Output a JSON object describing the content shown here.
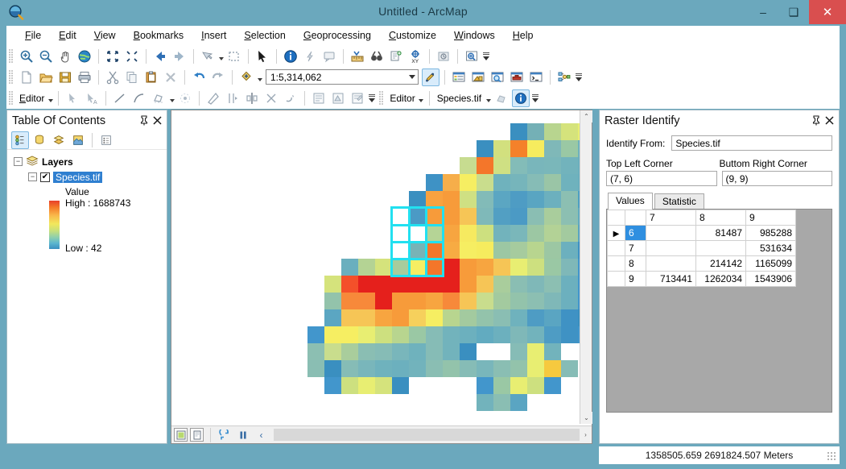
{
  "window": {
    "title": "Untitled - ArcMap",
    "app_icon": "magnifier-globe-icon",
    "minimize": "–",
    "maximize": "❑",
    "close": "✕"
  },
  "menu": {
    "items": [
      {
        "label": "File",
        "accel": "F"
      },
      {
        "label": "Edit",
        "accel": "E"
      },
      {
        "label": "View",
        "accel": "V"
      },
      {
        "label": "Bookmarks",
        "accel": "B"
      },
      {
        "label": "Insert",
        "accel": "I"
      },
      {
        "label": "Selection",
        "accel": "S"
      },
      {
        "label": "Geoprocessing",
        "accel": "G"
      },
      {
        "label": "Customize",
        "accel": "C"
      },
      {
        "label": "Windows",
        "accel": "W"
      },
      {
        "label": "Help",
        "accel": "H"
      }
    ]
  },
  "toolbars": {
    "tools": {
      "icons": [
        "zoom-in-icon",
        "zoom-out-icon",
        "pan-icon",
        "full-extent-globe-icon",
        "fixed-zoom-in-icon",
        "fixed-zoom-out-icon",
        "go-back-extent-icon",
        "go-forward-extent-icon",
        "select-features-icon",
        "select-rectangle-icon",
        "select-elements-arrow-icon",
        "identify-icon",
        "hyperlink-icon",
        "html-popup-icon",
        "measure-icon",
        "find-icon",
        "find-route-icon",
        "go-to-xy-icon",
        "time-slider-icon",
        "create-viewer-window-icon"
      ]
    },
    "standard": {
      "icons": [
        "new-map-icon",
        "open-icon",
        "save-icon",
        "print-icon",
        "cut-icon",
        "copy-icon",
        "paste-icon",
        "delete-icon",
        "undo-icon",
        "redo-icon",
        "add-data-icon"
      ],
      "scale_label": "1:5,314,062",
      "right_icons": [
        "editor-toolbar-icon",
        "table-of-contents-icon",
        "catalog-icon",
        "search-icon",
        "arctoolbox-icon",
        "python-window-icon",
        "model-builder-icon"
      ]
    },
    "editor": {
      "menu_label": "Editor",
      "icons": [
        "edit-tool-icon",
        "edit-annotation-icon",
        "straight-segment-icon",
        "arc-segment-icon",
        "trace-icon",
        "point-icon",
        "rotate-icon",
        "split-icon",
        "mirror-icon",
        "cut-polygons-icon",
        "reshape-icon",
        "attributes-icon",
        "sketch-properties-icon",
        "create-features-icon"
      ]
    },
    "raster_identify_bar": {
      "menu_label": "Editor",
      "layer": "Species.tif",
      "icons": [
        "raster-select-icon",
        "raster-identify-icon"
      ]
    }
  },
  "toc": {
    "title": "Table Of Contents",
    "pin_icon": "pin-icon",
    "close_icon": "close-icon",
    "toolbar_icons": [
      "list-by-drawing-order-icon",
      "list-by-source-icon",
      "list-by-visibility-icon",
      "list-by-selection-icon",
      "options-icon"
    ],
    "root": "Layers",
    "layer": "Species.tif",
    "layer_checked": "✔",
    "legend": {
      "heading": "Value",
      "high": "High : 1688743",
      "low": "Low : 42",
      "ramp_colors": [
        "#e8402a",
        "#f47b28",
        "#f9b64a",
        "#f2e85c",
        "#c9e07a",
        "#8dcfae",
        "#5bb6cf",
        "#3a8fc0"
      ]
    }
  },
  "map": {
    "bottom_icons": [
      "data-view-icon",
      "layout-view-icon",
      "refresh-icon",
      "pause-drawing-icon",
      "previous-extent-icon"
    ],
    "scroll_left_icon": "‹",
    "scroll_right_icon": "›",
    "scroll_up_icon": "⌃",
    "scroll_down_icon": "⌄",
    "selection": {
      "cols": 3,
      "rows": 4,
      "top_left": "(7, 6)",
      "bottom_right": "(9, 9)",
      "outline_color": "#22e0f0"
    }
  },
  "raster_identify": {
    "title": "Raster Identify",
    "pin_icon": "pin-icon",
    "close_icon": "close-icon",
    "identify_from_label": "Identify From:",
    "identify_from_value": "Species.tif",
    "top_left_label": "Top Left Corner",
    "top_left_value": "(7, 6)",
    "bottom_right_label": "Buttom Right Corner",
    "bottom_right_value": "(9, 9)",
    "tabs": [
      {
        "label": "Values",
        "active": true
      },
      {
        "label": "Statistic",
        "active": false
      }
    ],
    "table": {
      "column_headers": [
        "7",
        "8",
        "9"
      ],
      "rows": [
        {
          "header": "6",
          "active": true,
          "indicator": "▶",
          "cells": [
            "",
            "81487",
            "985288"
          ]
        },
        {
          "header": "7",
          "active": false,
          "indicator": "",
          "cells": [
            "",
            "",
            "531634"
          ]
        },
        {
          "header": "8",
          "active": false,
          "indicator": "",
          "cells": [
            "",
            "214142",
            "1165099"
          ]
        },
        {
          "header": "9",
          "active": false,
          "indicator": "",
          "cells": [
            "713441",
            "1262034",
            "1543906"
          ]
        }
      ]
    }
  },
  "statusbar": {
    "coordinates": "1358505.659  2691824.507 Meters"
  },
  "chart_data": {
    "type": "heatmap",
    "title": "Species.tif raster",
    "cell_size_px": 21,
    "origin": [
      234,
      152
    ],
    "legend_high": 1688743,
    "legend_low": 42,
    "cells": [
      [
        19,
        0,
        "#3a8fc0"
      ],
      [
        20,
        0,
        "#74b0b6"
      ],
      [
        21,
        0,
        "#b8d58f"
      ],
      [
        22,
        0,
        "#d5e37c"
      ],
      [
        23,
        0,
        "#e8ee72"
      ],
      [
        24,
        0,
        "#4296cc"
      ],
      [
        17,
        1,
        "#3a8fc0"
      ],
      [
        18,
        1,
        "#d2e07e"
      ],
      [
        19,
        1,
        "#f4812a"
      ],
      [
        20,
        1,
        "#f6ec5e"
      ],
      [
        21,
        1,
        "#7fb8b8"
      ],
      [
        22,
        1,
        "#9ac8a4"
      ],
      [
        23,
        1,
        "#6fb2bd"
      ],
      [
        24,
        1,
        "#3f92c4"
      ],
      [
        16,
        2,
        "#c7dc90"
      ],
      [
        17,
        2,
        "#f4762a"
      ],
      [
        18,
        2,
        "#cfe083"
      ],
      [
        19,
        2,
        "#83bcb8"
      ],
      [
        20,
        2,
        "#79b6bb"
      ],
      [
        21,
        2,
        "#7ab7ba"
      ],
      [
        22,
        2,
        "#72b3bc"
      ],
      [
        23,
        2,
        "#6cb0be"
      ],
      [
        24,
        2,
        "#4e9cc4"
      ],
      [
        14,
        3,
        "#3e92c5"
      ],
      [
        15,
        3,
        "#f6ae4a"
      ],
      [
        16,
        3,
        "#f6ee62"
      ],
      [
        17,
        3,
        "#c9dd8d"
      ],
      [
        18,
        3,
        "#6fb2bd"
      ],
      [
        19,
        3,
        "#76b5bb"
      ],
      [
        20,
        3,
        "#86bcb6"
      ],
      [
        21,
        3,
        "#9ac5a6"
      ],
      [
        22,
        3,
        "#6fb2bd"
      ],
      [
        23,
        3,
        "#6aafbe"
      ],
      [
        24,
        3,
        "#3f92c4"
      ],
      [
        13,
        4,
        "#3a8fc0"
      ],
      [
        14,
        4,
        "#f8a23f"
      ],
      [
        15,
        4,
        "#f79b3a"
      ],
      [
        16,
        4,
        "#cfe083"
      ],
      [
        17,
        4,
        "#82bbb8"
      ],
      [
        18,
        4,
        "#5ba6c2"
      ],
      [
        19,
        4,
        "#4e9cc4"
      ],
      [
        20,
        4,
        "#59a5c2"
      ],
      [
        21,
        4,
        "#6cb0be"
      ],
      [
        22,
        4,
        "#8cbfb2"
      ],
      [
        23,
        4,
        "#4fa0c3"
      ],
      [
        24,
        4,
        "#3f92c4"
      ],
      [
        12,
        5,
        "#ffffff"
      ],
      [
        13,
        5,
        "#4b9ac5"
      ],
      [
        14,
        5,
        "#f79b3a"
      ],
      [
        15,
        5,
        "#f79b3a"
      ],
      [
        16,
        5,
        "#f6c556"
      ],
      [
        17,
        5,
        "#7fb9b9"
      ],
      [
        18,
        5,
        "#529fc3"
      ],
      [
        19,
        5,
        "#4b9ac5"
      ],
      [
        20,
        5,
        "#8abeb3"
      ],
      [
        21,
        5,
        "#a9cd9c"
      ],
      [
        22,
        5,
        "#8cbfb2"
      ],
      [
        23,
        5,
        "#62abc0"
      ],
      [
        24,
        5,
        "#3f92c4"
      ],
      [
        12,
        6,
        "#ffffff"
      ],
      [
        13,
        6,
        "#ffffff"
      ],
      [
        14,
        6,
        "#b5d496"
      ],
      [
        15,
        6,
        "#f7a540"
      ],
      [
        16,
        6,
        "#f6ea60"
      ],
      [
        17,
        6,
        "#cde07f"
      ],
      [
        18,
        6,
        "#72b3bc"
      ],
      [
        19,
        6,
        "#7ab7ba"
      ],
      [
        20,
        6,
        "#9cc7a3"
      ],
      [
        21,
        6,
        "#b3d296"
      ],
      [
        22,
        6,
        "#a3ca9f"
      ],
      [
        23,
        6,
        "#5aa5c2"
      ],
      [
        24,
        6,
        "#3a8fc0"
      ],
      [
        12,
        7,
        "#ffffff"
      ],
      [
        13,
        7,
        "#78b3b6"
      ],
      [
        14,
        7,
        "#f4762a"
      ],
      [
        15,
        7,
        "#f7ab43"
      ],
      [
        16,
        7,
        "#f6ee62"
      ],
      [
        17,
        7,
        "#f6ec5e"
      ],
      [
        18,
        7,
        "#9cc7a3"
      ],
      [
        19,
        7,
        "#a6cb9e"
      ],
      [
        20,
        7,
        "#b8d58f"
      ],
      [
        21,
        7,
        "#9cc7a3"
      ],
      [
        22,
        7,
        "#6cb0be"
      ],
      [
        23,
        7,
        "#3f92c4"
      ],
      [
        24,
        7,
        "#3f92c4"
      ],
      [
        9,
        8,
        "#6aafbe"
      ],
      [
        10,
        8,
        "#b4d394"
      ],
      [
        11,
        8,
        "#d5e37c"
      ],
      [
        12,
        8,
        "#a8cc9c"
      ],
      [
        13,
        8,
        "#f6ee62"
      ],
      [
        14,
        8,
        "#f4762a"
      ],
      [
        15,
        8,
        "#e5201c"
      ],
      [
        16,
        8,
        "#f79b3a"
      ],
      [
        17,
        8,
        "#f7a540"
      ],
      [
        18,
        8,
        "#f6c556"
      ],
      [
        19,
        8,
        "#e8ee72"
      ],
      [
        20,
        8,
        "#cde07f"
      ],
      [
        21,
        8,
        "#9ac8a4"
      ],
      [
        22,
        8,
        "#7fb8b8"
      ],
      [
        23,
        8,
        "#4296cc"
      ],
      [
        8,
        9,
        "#d5e37c"
      ],
      [
        9,
        9,
        "#f4502a"
      ],
      [
        10,
        9,
        "#e5201c"
      ],
      [
        11,
        9,
        "#e5201c"
      ],
      [
        12,
        9,
        "#e5201c"
      ],
      [
        13,
        9,
        "#e5201c"
      ],
      [
        14,
        9,
        "#e5201c"
      ],
      [
        15,
        9,
        "#e5201c"
      ],
      [
        16,
        9,
        "#f79b3a"
      ],
      [
        17,
        9,
        "#f6c556"
      ],
      [
        18,
        9,
        "#a9cd9c"
      ],
      [
        19,
        9,
        "#8abeb3"
      ],
      [
        20,
        9,
        "#7fb8b8"
      ],
      [
        21,
        9,
        "#8cbfb2"
      ],
      [
        22,
        9,
        "#6cb0be"
      ],
      [
        23,
        9,
        "#4296cc"
      ],
      [
        8,
        10,
        "#93c3ab"
      ],
      [
        9,
        10,
        "#f7893a"
      ],
      [
        10,
        10,
        "#f7893a"
      ],
      [
        11,
        10,
        "#e5201c"
      ],
      [
        12,
        10,
        "#f79b3a"
      ],
      [
        13,
        10,
        "#f79b3a"
      ],
      [
        14,
        10,
        "#f7a540"
      ],
      [
        15,
        10,
        "#f7893a"
      ],
      [
        16,
        10,
        "#f6c556"
      ],
      [
        17,
        10,
        "#c9dd8d"
      ],
      [
        18,
        10,
        "#a3ca9f"
      ],
      [
        19,
        10,
        "#93c3ab"
      ],
      [
        20,
        10,
        "#8cbfb2"
      ],
      [
        21,
        10,
        "#7fb8b8"
      ],
      [
        22,
        10,
        "#6cb0be"
      ],
      [
        23,
        10,
        "#4296cc"
      ],
      [
        8,
        11,
        "#5ba6c2"
      ],
      [
        9,
        11,
        "#f6c556"
      ],
      [
        10,
        11,
        "#f6c556"
      ],
      [
        11,
        11,
        "#f7a540"
      ],
      [
        12,
        11,
        "#f79b3a"
      ],
      [
        13,
        11,
        "#f6d05c"
      ],
      [
        14,
        11,
        "#f6ee62"
      ],
      [
        15,
        11,
        "#b8d58f"
      ],
      [
        16,
        11,
        "#a3ca9f"
      ],
      [
        17,
        11,
        "#93c3ab"
      ],
      [
        18,
        11,
        "#8abeb3"
      ],
      [
        19,
        11,
        "#6fb2bd"
      ],
      [
        20,
        11,
        "#4e9cc4"
      ],
      [
        21,
        11,
        "#5aa5c2"
      ],
      [
        22,
        11,
        "#3f92c4"
      ],
      [
        23,
        11,
        "#3a8fc0"
      ],
      [
        7,
        12,
        "#4296cc"
      ],
      [
        8,
        12,
        "#f6ee62"
      ],
      [
        9,
        12,
        "#f6ee62"
      ],
      [
        10,
        12,
        "#e8ee72"
      ],
      [
        11,
        12,
        "#cde07f"
      ],
      [
        12,
        12,
        "#b8d58f"
      ],
      [
        13,
        12,
        "#9ac8a4"
      ],
      [
        14,
        12,
        "#86bcb6"
      ],
      [
        15,
        12,
        "#72b3bc"
      ],
      [
        16,
        12,
        "#6cb0be"
      ],
      [
        17,
        12,
        "#62abc0"
      ],
      [
        18,
        12,
        "#6cb0be"
      ],
      [
        19,
        12,
        "#7fb8b8"
      ],
      [
        20,
        12,
        "#72b3bc"
      ],
      [
        21,
        12,
        "#4e9cc4"
      ],
      [
        22,
        12,
        "#3f92c4"
      ],
      [
        23,
        12,
        "#4296cc"
      ],
      [
        26,
        12,
        "#6cb0be"
      ],
      [
        27,
        12,
        "#4296cc"
      ],
      [
        7,
        13,
        "#8cbfb2"
      ],
      [
        8,
        13,
        "#c9dd8d"
      ],
      [
        9,
        13,
        "#a9cd9c"
      ],
      [
        10,
        13,
        "#8abeb3"
      ],
      [
        11,
        13,
        "#86bcb6"
      ],
      [
        12,
        13,
        "#79b6bb"
      ],
      [
        13,
        13,
        "#6fb2bd"
      ],
      [
        14,
        13,
        "#86bcb6"
      ],
      [
        15,
        13,
        "#72b3bc"
      ],
      [
        16,
        13,
        "#3a8fc0"
      ],
      [
        19,
        13,
        "#86bcb6"
      ],
      [
        20,
        13,
        "#e8ee72"
      ],
      [
        21,
        13,
        "#72b3bc"
      ],
      [
        24,
        13,
        "#7fb8b8"
      ],
      [
        25,
        13,
        "#e8ee72"
      ],
      [
        26,
        13,
        "#72b3bc"
      ],
      [
        7,
        14,
        "#8abeb3"
      ],
      [
        8,
        14,
        "#3a8fc0"
      ],
      [
        9,
        14,
        "#86bcb6"
      ],
      [
        10,
        14,
        "#79b6bb"
      ],
      [
        11,
        14,
        "#6fb2bd"
      ],
      [
        12,
        14,
        "#6cb0be"
      ],
      [
        13,
        14,
        "#72b3bc"
      ],
      [
        14,
        14,
        "#8abeb3"
      ],
      [
        15,
        14,
        "#93c3ab"
      ],
      [
        16,
        14,
        "#86bcb6"
      ],
      [
        17,
        14,
        "#79b6bb"
      ],
      [
        18,
        14,
        "#8abeb3"
      ],
      [
        19,
        14,
        "#93c3ab"
      ],
      [
        20,
        14,
        "#e8ee72"
      ],
      [
        21,
        14,
        "#f6c93f"
      ],
      [
        22,
        14,
        "#86bcb6"
      ],
      [
        8,
        15,
        "#4296cc"
      ],
      [
        9,
        15,
        "#cde07f"
      ],
      [
        10,
        15,
        "#e8ee72"
      ],
      [
        11,
        15,
        "#d5e37c"
      ],
      [
        12,
        15,
        "#3a8fc0"
      ],
      [
        17,
        15,
        "#4296cc"
      ],
      [
        18,
        15,
        "#9ac8a4"
      ],
      [
        19,
        15,
        "#e8ee72"
      ],
      [
        20,
        15,
        "#cde07f"
      ],
      [
        21,
        15,
        "#4296cc"
      ],
      [
        17,
        16,
        "#72b3bc"
      ],
      [
        18,
        16,
        "#8abeb3"
      ],
      [
        19,
        16,
        "#5aa5c2"
      ]
    ]
  }
}
